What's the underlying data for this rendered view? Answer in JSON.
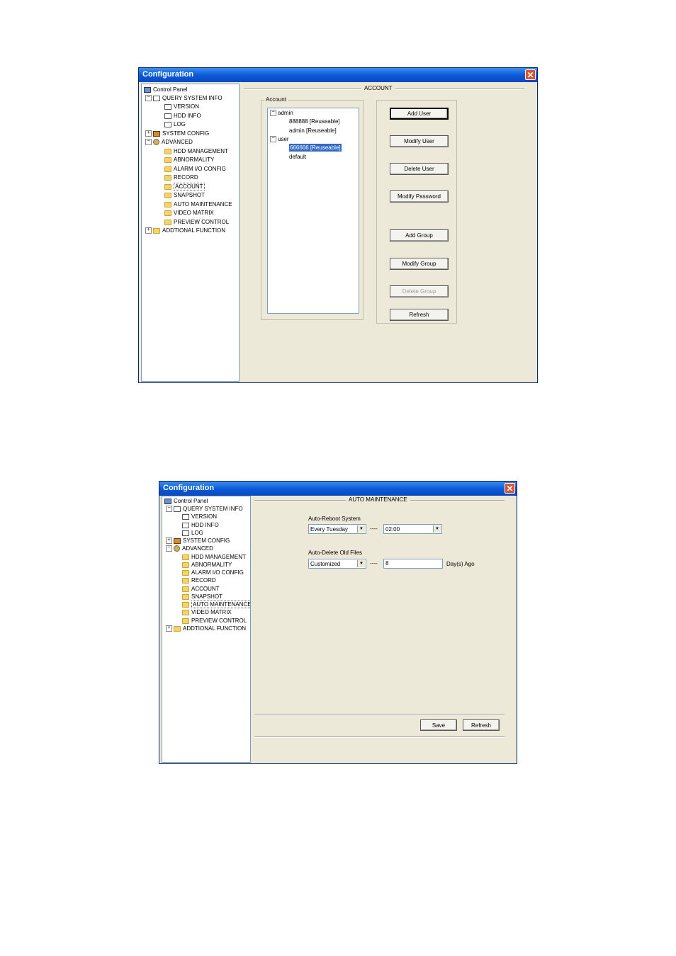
{
  "window1": {
    "title": "Configuration",
    "close_glyph": "✕",
    "section_title": "ACCOUNT",
    "tree": {
      "root": "Control Panel",
      "query_system_info": "QUERY SYSTEM INFO",
      "version": "VERSION",
      "hdd_info": "HDD INFO",
      "log": "LOG",
      "system_config": "SYSTEM CONFIG",
      "advanced": "ADVANCED",
      "hdd_management": "HDD MANAGEMENT",
      "abnormality": "ABNORMALITY",
      "alarm_io_config": "ALARM I/O CONFIG",
      "record": "RECORD",
      "account": "ACCOUNT",
      "snapshot": "SNAPSHOT",
      "auto_maintenance": "AUTO MAINTENANCE",
      "video_matrix": "VIDEO MATRIX",
      "preview_control": "PREVIEW CONTROL",
      "additional_function": "ADDTIONAL FUNCTION"
    },
    "account_group": {
      "legend": "Account",
      "admin": "admin",
      "admin_user1": "888888 [Reuseable]",
      "admin_user2": "admin [Reuseable]",
      "user": "user",
      "user_user1": "666666 [Reuseable]",
      "user_user2": "default"
    },
    "buttons": {
      "add_user": "Add User",
      "modify_user": "Modify User",
      "delete_user": "Delete User",
      "modify_password": "Modify Password",
      "add_group": "Add Group",
      "modify_group": "Modify Group",
      "delete_group": "Delete Group",
      "refresh": "Refresh"
    }
  },
  "window2": {
    "title": "Configuration",
    "close_glyph": "✕",
    "section_title": "AUTO MAINTENANCE",
    "tree": {
      "root": "Control Panel",
      "query_system_info": "QUERY SYSTEM INFO",
      "version": "VERSION",
      "hdd_info": "HDD INFO",
      "log": "LOG",
      "system_config": "SYSTEM CONFIG",
      "advanced": "ADVANCED",
      "hdd_management": "HDD MANAGEMENT",
      "abnormality": "ABNORMALITY",
      "alarm_io_config": "ALARM I/O CONFIG",
      "record": "RECORD",
      "account": "ACCOUNT",
      "snapshot": "SNAPSHOT",
      "auto_maintenance": "AUTO MAINTENANCE",
      "video_matrix": "VIDEO MATRIX",
      "preview_control": "PREVIEW CONTROL",
      "additional_function": "ADDTIONAL FUNCTION"
    },
    "auto_reboot_label": "Auto-Reboot System",
    "reboot_day": "Every Tuesday",
    "reboot_time": "02:00",
    "auto_delete_label": "Auto-Delete Old Files",
    "delete_mode": "Customized",
    "delete_days": "8",
    "days_unit": "Day(s) Ago",
    "dash": "----",
    "buttons": {
      "save": "Save",
      "refresh": "Refresh"
    }
  },
  "icons": {
    "close": "close-icon",
    "folder": "folder-icon",
    "document": "document-icon",
    "computer": "computer-icon",
    "settings": "settings-icon",
    "expand": "expand-icon",
    "collapse": "collapse-icon",
    "dropdown": "dropdown-arrow-icon"
  }
}
